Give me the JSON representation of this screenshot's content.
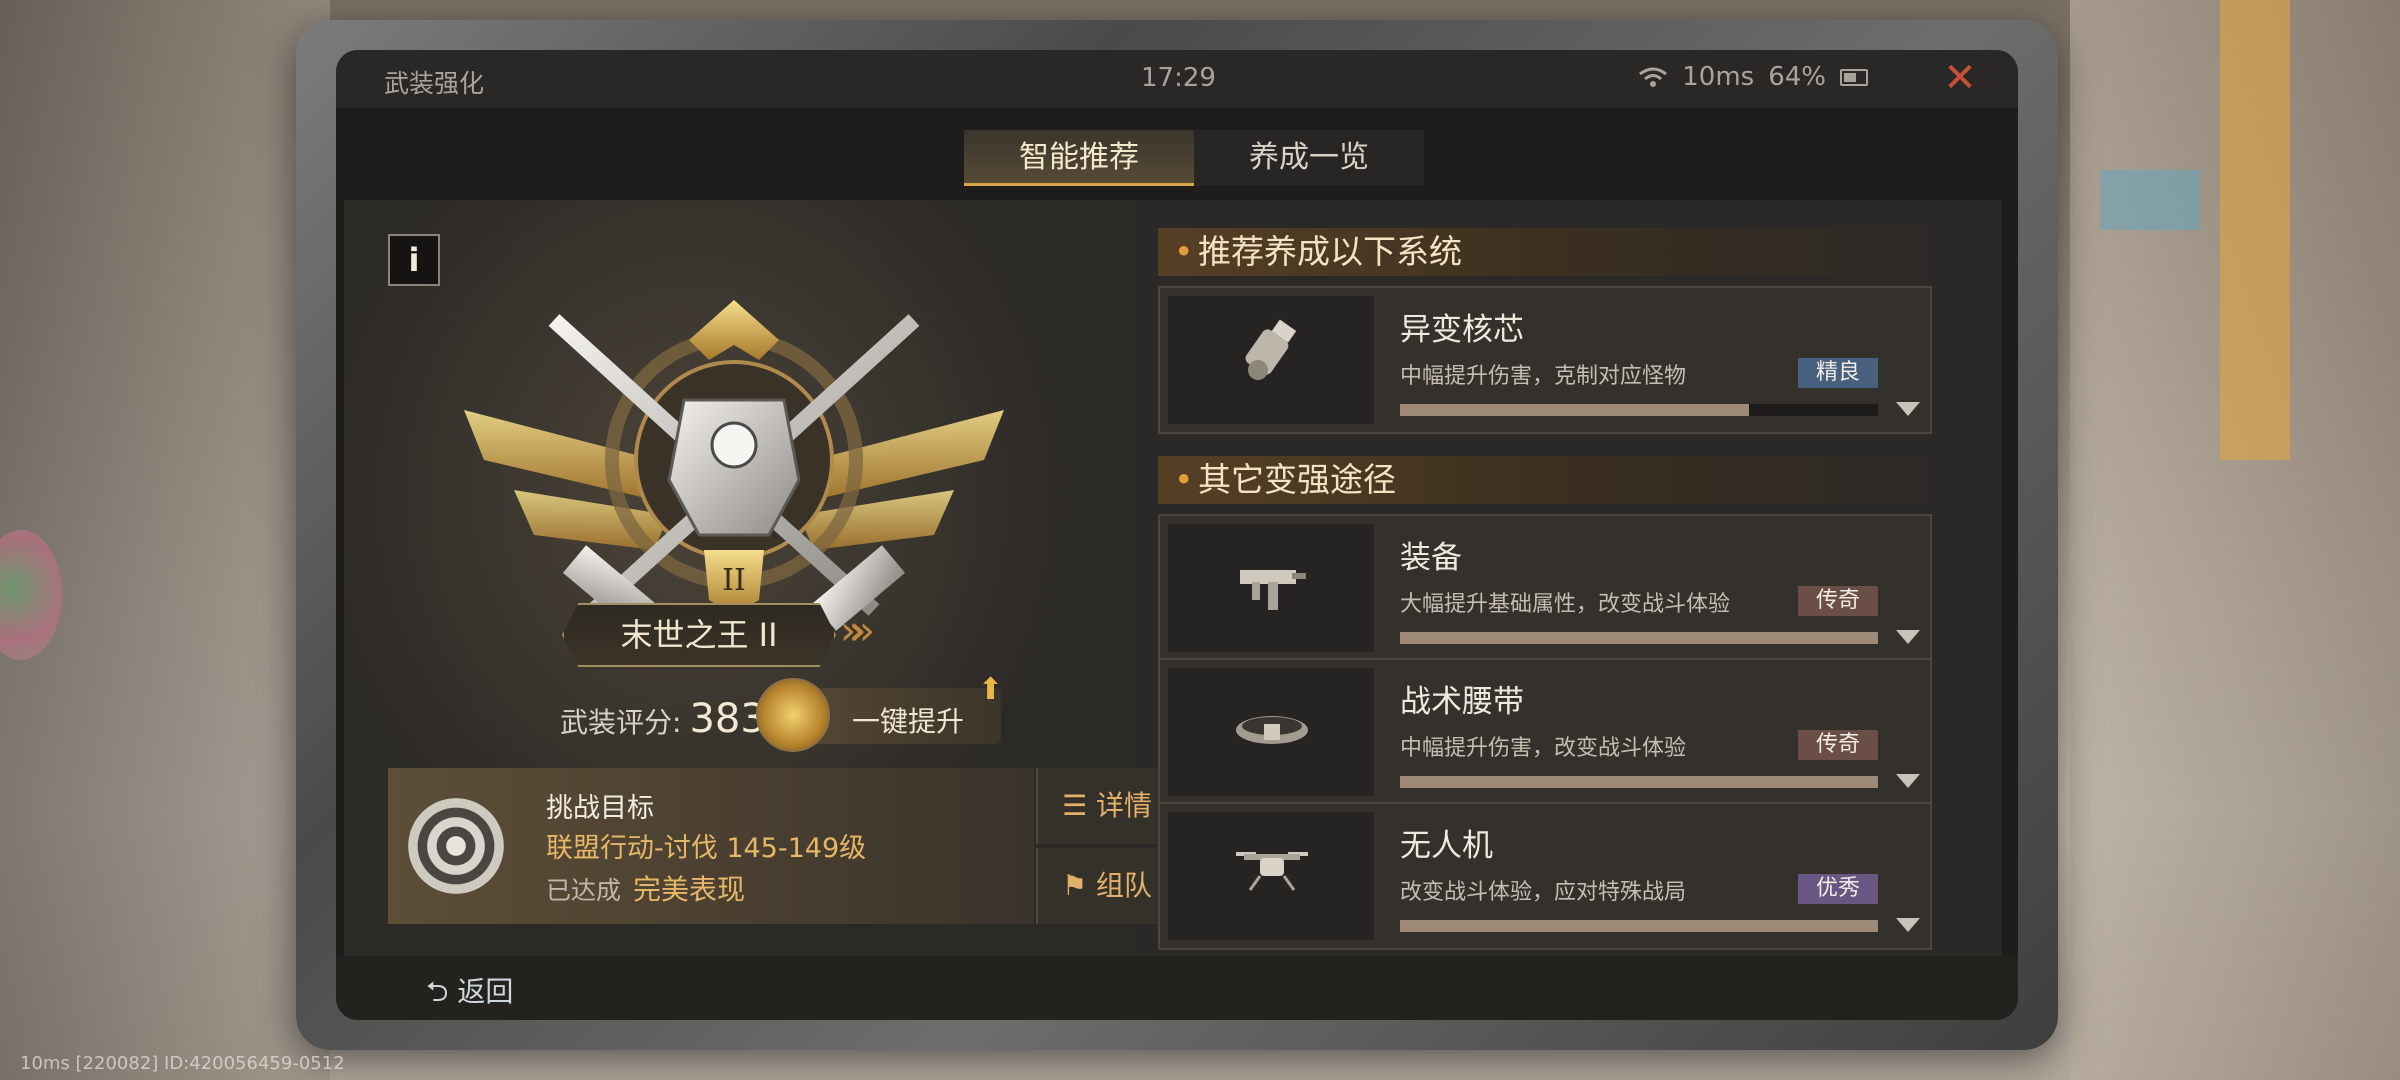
{
  "window": {
    "title": "武装强化",
    "time": "17:29",
    "latency": "10ms",
    "battery": "64%"
  },
  "tabs": [
    {
      "label": "智能推荐",
      "active": true
    },
    {
      "label": "养成一览",
      "active": false
    }
  ],
  "rank": {
    "name": "末世之王 II",
    "score_label": "武装评分:",
    "score": "38325"
  },
  "upgrade_button": {
    "label": "一键提升"
  },
  "challenge": {
    "title": "挑战目标",
    "target": "联盟行动-讨伐  145-149级",
    "status_label": "已达成",
    "status_value": "完美表现",
    "details_label": "详情",
    "team_label": "组队"
  },
  "recommend": {
    "header": "推荐养成以下系统",
    "items": [
      {
        "name": "异变核芯",
        "desc": "中幅提升伤害，克制对应怪物",
        "badge": "精良",
        "badge_color": "#46607e",
        "progress": 0.73,
        "icon": "mutation-core-icon"
      }
    ]
  },
  "other": {
    "header": "其它变强途径",
    "items": [
      {
        "name": "装备",
        "desc": "大幅提升基础属性，改变战斗体验",
        "badge": "传奇",
        "badge_color": "#6a4e47",
        "progress": 1.0,
        "icon": "smg-icon"
      },
      {
        "name": "战术腰带",
        "desc": "中幅提升伤害，改变战斗体验",
        "badge": "传奇",
        "badge_color": "#6a4e47",
        "progress": 1.0,
        "icon": "belt-icon"
      },
      {
        "name": "无人机",
        "desc": "改变战斗体验，应对特殊战局",
        "badge": "优秀",
        "badge_color": "#6a5683",
        "progress": 1.0,
        "icon": "drone-icon"
      }
    ]
  },
  "footer": {
    "back_label": "返回",
    "overlay": "10ms  [220082] ID:420056459-0512"
  }
}
